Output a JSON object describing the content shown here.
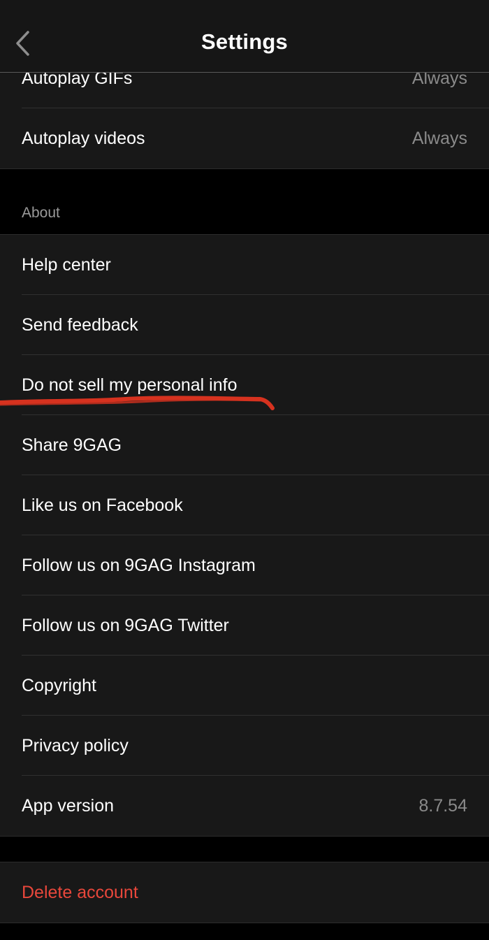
{
  "navbar": {
    "title": "Settings",
    "back_icon": "chevron-left-icon"
  },
  "playback": {
    "items": [
      {
        "label": "Autoplay GIFs",
        "value": "Always"
      },
      {
        "label": "Autoplay videos",
        "value": "Always"
      }
    ]
  },
  "about": {
    "header": "About",
    "items": [
      {
        "label": "Help center"
      },
      {
        "label": "Send feedback"
      },
      {
        "label": "Do not sell my personal info"
      },
      {
        "label": "Share 9GAG"
      },
      {
        "label": "Like us on Facebook"
      },
      {
        "label": "Follow us on 9GAG Instagram"
      },
      {
        "label": "Follow us on 9GAG Twitter"
      },
      {
        "label": "Copyright"
      },
      {
        "label": "Privacy policy"
      },
      {
        "label": "App version",
        "value": "8.7.54"
      }
    ]
  },
  "account": {
    "delete_label": "Delete account"
  },
  "colors": {
    "background": "#000000",
    "cell": "#181818",
    "danger": "#e8473b",
    "scribble": "#d6321f"
  }
}
